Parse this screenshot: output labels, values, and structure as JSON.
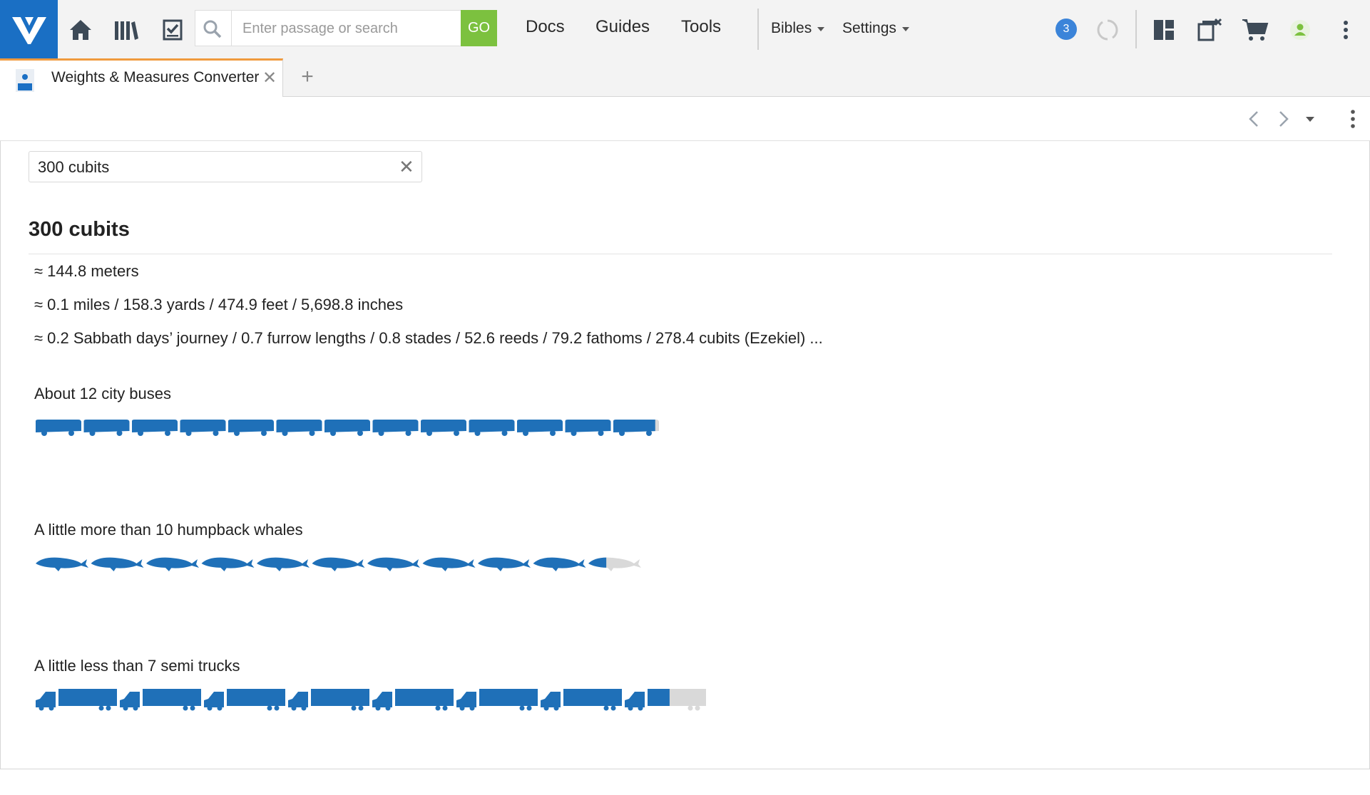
{
  "topbar": {
    "search_placeholder": "Enter passage or search",
    "go_label": "GO",
    "nav": [
      "Docs",
      "Guides",
      "Tools"
    ],
    "bibles_label": "Bibles",
    "settings_label": "Settings",
    "notification_count": "3"
  },
  "tabs": [
    {
      "title": "Weights & Measures Converter"
    }
  ],
  "converter": {
    "query": "300 cubits",
    "heading": "300 cubits",
    "conversions": [
      "≈ 144.8 meters",
      "≈ 0.1 miles / 158.3 yards / 474.9 feet / 5,698.8 inches",
      "≈ 0.2 Sabbath days’ journey / 0.7 furrow lengths / 0.8 stades / 52.6 reeds / 79.2 fathoms / 278.4 cubits (Ezekiel) ..."
    ],
    "comparisons": [
      {
        "label": "About 12 city buses",
        "icon": "bus-icon",
        "count": 12,
        "fraction": 0.9
      },
      {
        "label": "A little more than 10 humpback whales",
        "icon": "whale-icon",
        "count": 10,
        "fraction": 0.35
      },
      {
        "label": "A little less than 7 semi trucks",
        "icon": "semi-truck-icon",
        "count": 7,
        "fraction": 0.55
      }
    ]
  },
  "colors": {
    "brand": "#1a6fc4",
    "go": "#7cc13f",
    "icon_fill": "#1f70b8",
    "icon_empty": "#d9d9d9",
    "tab_accent": "#f09a3e",
    "badge": "#3b84d9",
    "account": "#7cc13f"
  }
}
